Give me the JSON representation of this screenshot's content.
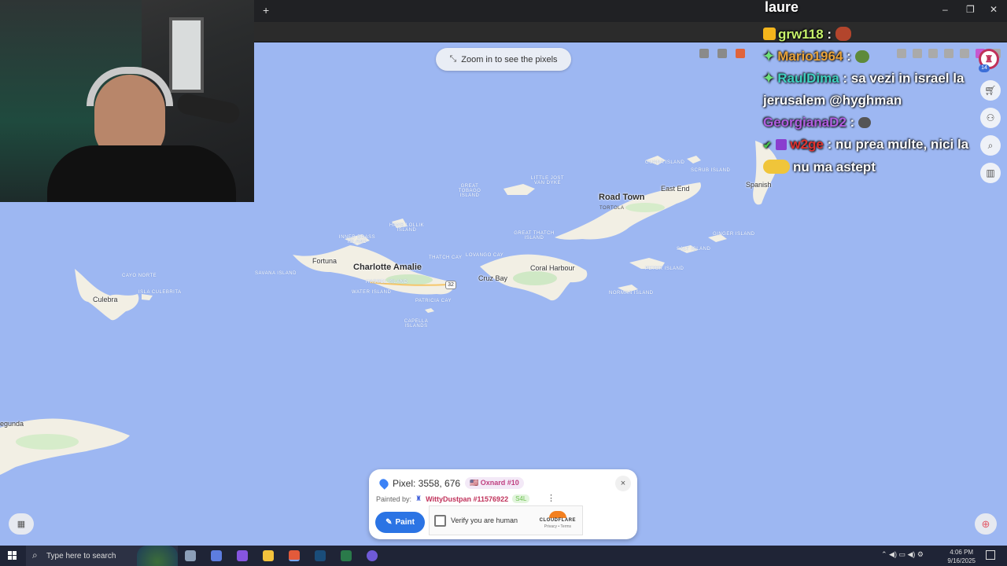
{
  "stream": {
    "name": "laure"
  },
  "browser": {
    "new_tab": "+",
    "minimize": "–",
    "restore": "❐",
    "close": "✕"
  },
  "map": {
    "zoom_hint": "Zoom in to see the pixels",
    "places": {
      "charlotte_amalie": "Charlotte Amalie",
      "road_town": "Road Town",
      "east_end": "East End",
      "cruz_bay": "Cruz Bay",
      "coral_harbour": "Coral Harbour",
      "fortuna": "Fortuna",
      "culebra": "Culebra",
      "segunda": "egunda",
      "spanish_town": "Spanish",
      "tortola": "TORTOLA",
      "guana_island": "GUANA ISLAND",
      "scrub_island": "SCRUB ISLAND",
      "great_tobago": "GREAT TOBAGO ISLAND",
      "little_jost": "LITTLE JOST VAN DYKE",
      "hans_lollik": "HANS LOLLIK ISLAND",
      "inner_brass": "INNER BRASS ISLAND",
      "savana_island": "SAVANA ISLAND",
      "thatch_cay": "THATCH CAY",
      "lovango_cay": "LOVANGO CAY",
      "great_thatch": "GREAT THATCH ISLAND",
      "hassel_island": "HASSEL ISLAND",
      "water_island": "WATER ISLAND",
      "patricia_cay": "PATRICIA CAY",
      "capella_islands": "CAPELLA ISLANDS",
      "cayo_norte": "CAYO NORTE",
      "isla_culebrita": "ISLA CULEBRITA",
      "ginger_island": "GINGER ISLAND",
      "salt_island": "SALT ISLAND",
      "peter_island": "PETER ISLAND",
      "norman_island": "NORMAN ISLAND",
      "route_32": "32"
    }
  },
  "chat": [
    {
      "user": "grw118",
      "message": ":"
    },
    {
      "user": "Mario1964",
      "message": ":"
    },
    {
      "user": "RaulDima",
      "message": ": sa vezi in israel la jerusalem @hyghman"
    },
    {
      "user": "GeorgianaD2",
      "message": ":"
    },
    {
      "user": "w2ge",
      "message": ": nu prea multe, nici la"
    },
    {
      "user": "",
      "message": "nu ma astept"
    }
  ],
  "panel": {
    "pixel_label": "Pixel: 3558, 676",
    "region_badge": "🇺🇸 Oxnard #10",
    "painted_by_label": "Painted by:",
    "painter": "WittyDustpan #11576922",
    "painter_tag": "S4L",
    "paint_button": "Paint",
    "verify_label": "Verify you are human",
    "cloudflare": "CLOUDFLARE",
    "cf_links": "Privacy • Terms",
    "close": "×"
  },
  "side_buttons": {
    "count": "14"
  },
  "taskbar": {
    "search_placeholder": "Type here to search",
    "time": "4:06 PM",
    "date": "9/16/2025"
  },
  "colors": {
    "water": "#9db7f2",
    "land": "#f2efe4",
    "accent_blue": "#2b74e4",
    "user_pink": "#c0315a"
  }
}
